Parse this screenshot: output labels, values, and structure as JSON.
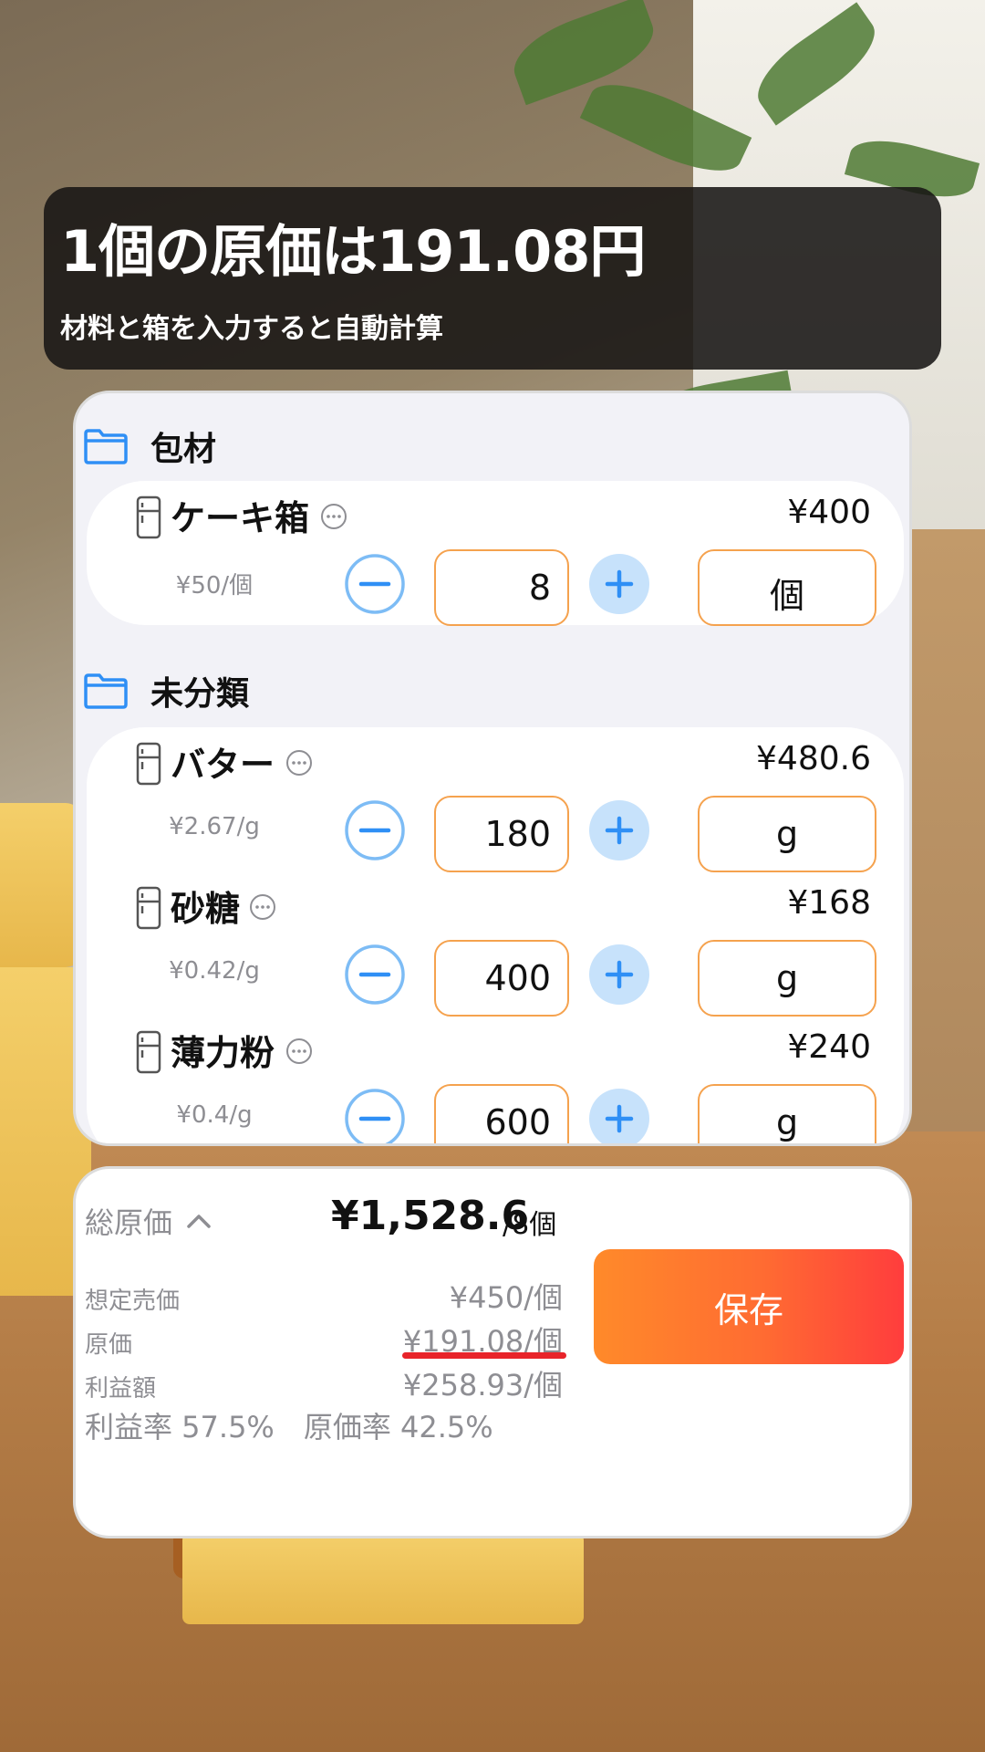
{
  "banner": {
    "title": "1個の原価は191.08円",
    "subtitle": "材料と箱を入力すると自動計算"
  },
  "sections": [
    {
      "label": "包材",
      "items": [
        {
          "name": "ケーキ箱",
          "price": "¥400",
          "unit_price": "¥50/個",
          "qty": "8",
          "unit": "個"
        }
      ]
    },
    {
      "label": "未分類",
      "items": [
        {
          "name": "バター",
          "price": "¥480.6",
          "unit_price": "¥2.67/g",
          "qty": "180",
          "unit": "g"
        },
        {
          "name": "砂糖",
          "price": "¥168",
          "unit_price": "¥0.42/g",
          "qty": "400",
          "unit": "g"
        },
        {
          "name": "薄力粉",
          "price": "¥240",
          "unit_price": "¥0.4/g",
          "qty": "600",
          "unit": "g"
        }
      ]
    }
  ],
  "summary": {
    "total_label": "総原価",
    "total_value": "¥1,528.6",
    "total_per": "/8個",
    "rows": [
      {
        "label": "想定売価",
        "value": "¥450/個"
      },
      {
        "label": "原価",
        "value": "¥191.08/個"
      },
      {
        "label": "利益額",
        "value": "¥258.93/個"
      }
    ],
    "ratio_text": "利益率 57.5%　原価率 42.5%",
    "save_label": "保存"
  },
  "colors": {
    "accent_blue": "#2f8ff5",
    "plus_bg": "#c7e2fb",
    "input_border": "#f5a24e",
    "save_gradient_start": "#ff8a2a",
    "save_gradient_end": "#ff3d3d",
    "underline_red": "#e8242a"
  },
  "icons": {
    "section": "folder-icon",
    "item": "fridge-icon",
    "more": "ellipsis-circle-icon",
    "decrease": "minus-circle-icon",
    "increase": "plus-circle-icon",
    "expand": "chevron-up-icon"
  }
}
